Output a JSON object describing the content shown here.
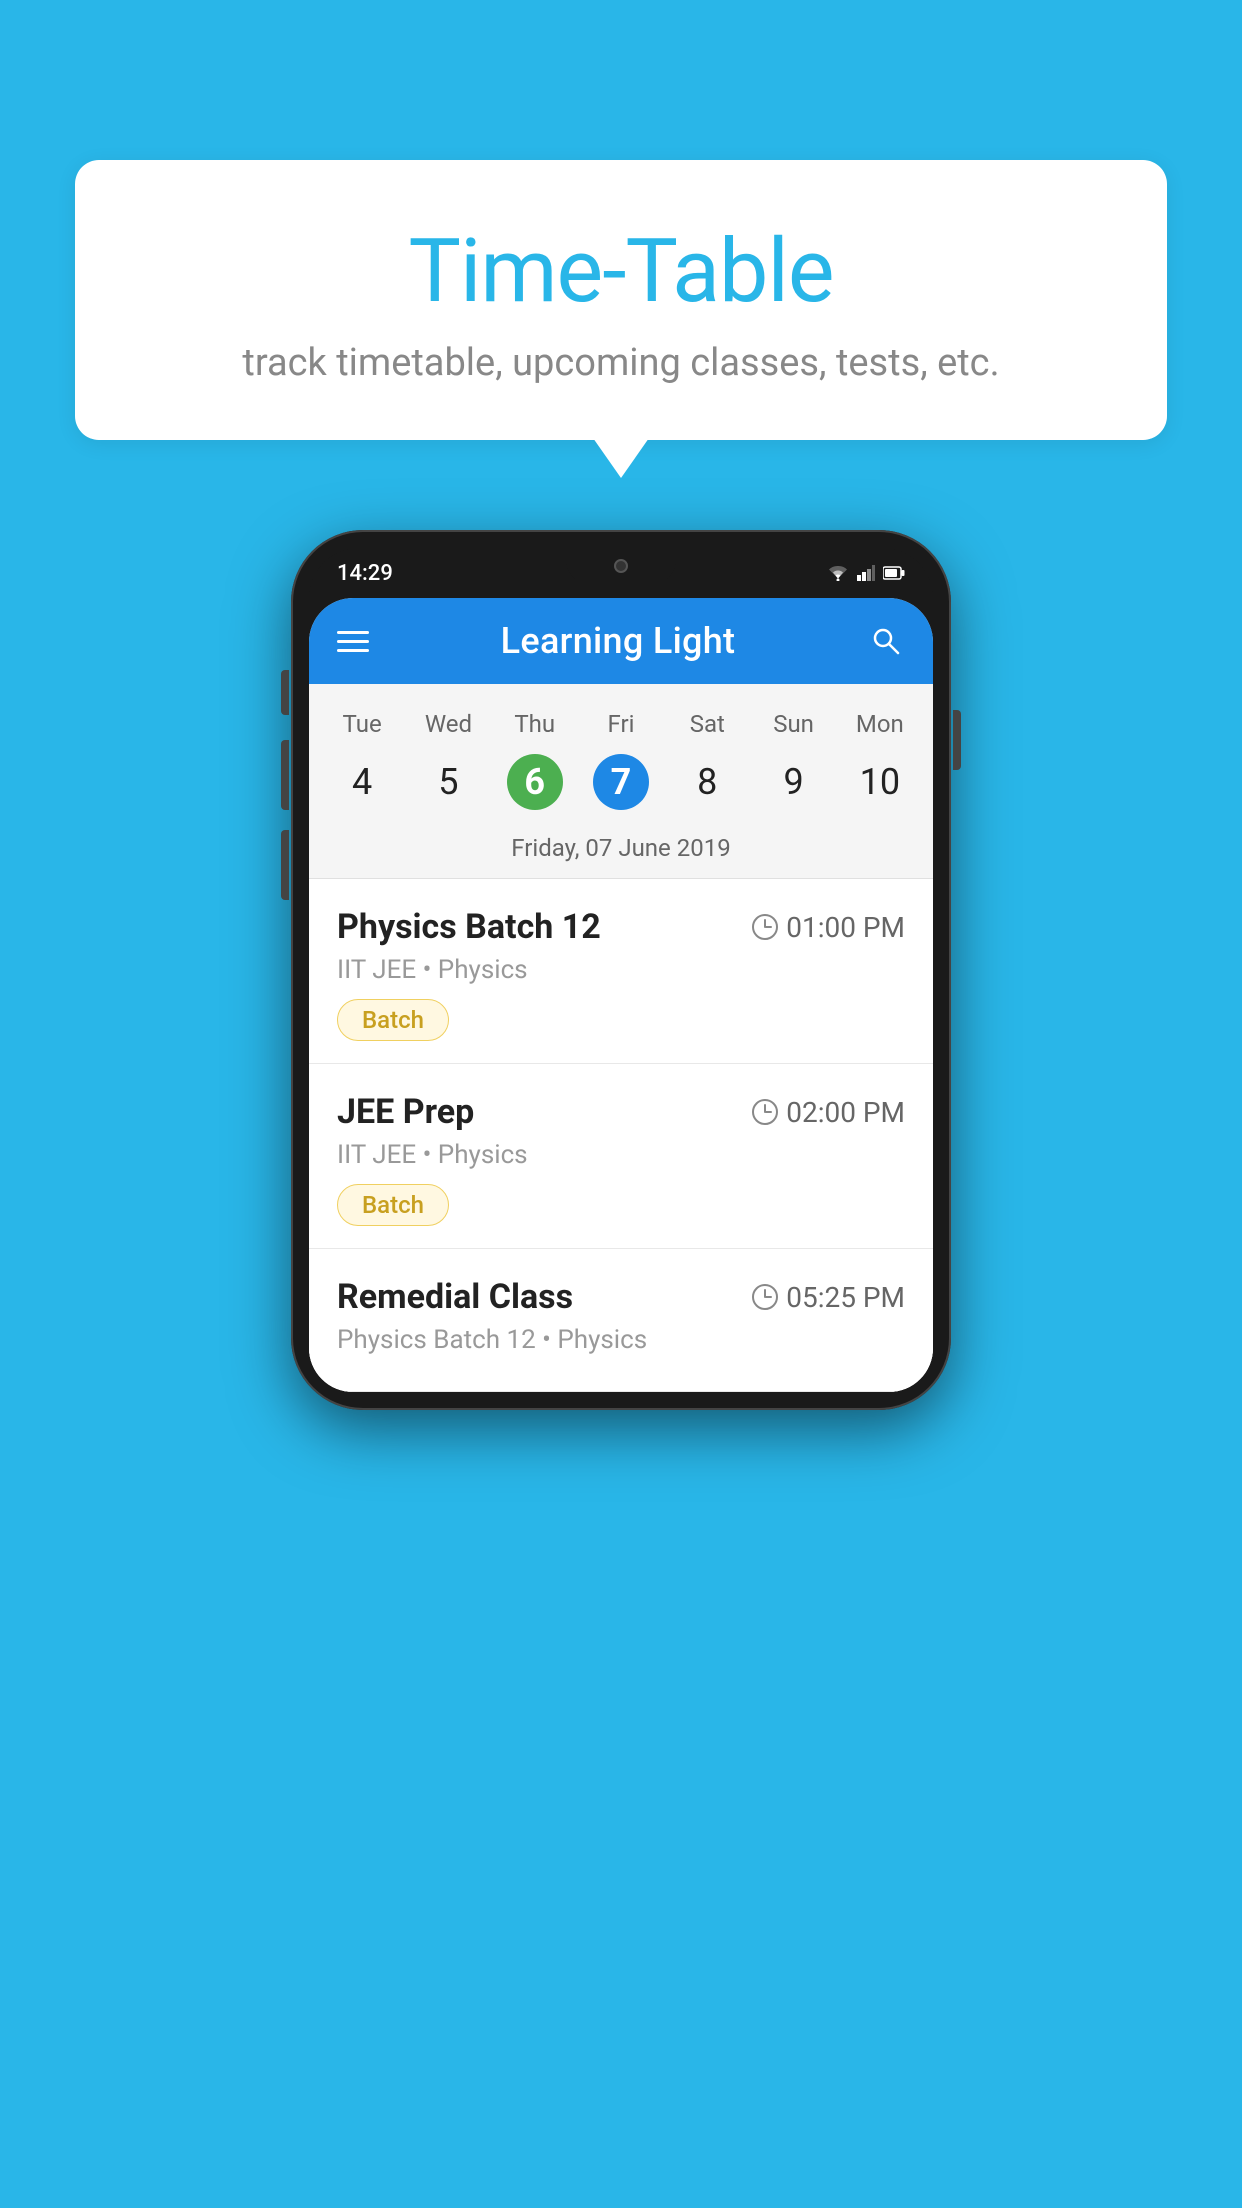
{
  "background_color": "#29b6e8",
  "speech_bubble": {
    "title": "Time-Table",
    "subtitle": "track timetable, upcoming classes, tests, etc."
  },
  "phone": {
    "status_bar": {
      "time": "14:29"
    },
    "app_bar": {
      "title": "Learning Light",
      "menu_label": "menu",
      "search_label": "search"
    },
    "calendar": {
      "days_of_week": [
        "Tue",
        "Wed",
        "Thu",
        "Fri",
        "Sat",
        "Sun",
        "Mon"
      ],
      "dates": [
        "4",
        "5",
        "6",
        "7",
        "8",
        "9",
        "10"
      ],
      "today_index": 2,
      "selected_index": 3,
      "selected_date_label": "Friday, 07 June 2019"
    },
    "schedule_items": [
      {
        "title": "Physics Batch 12",
        "time": "01:00 PM",
        "subtitle": "IIT JEE • Physics",
        "badge": "Batch"
      },
      {
        "title": "JEE Prep",
        "time": "02:00 PM",
        "subtitle": "IIT JEE • Physics",
        "badge": "Batch"
      },
      {
        "title": "Remedial Class",
        "time": "05:25 PM",
        "subtitle": "Physics Batch 12 • Physics",
        "badge": ""
      }
    ]
  }
}
